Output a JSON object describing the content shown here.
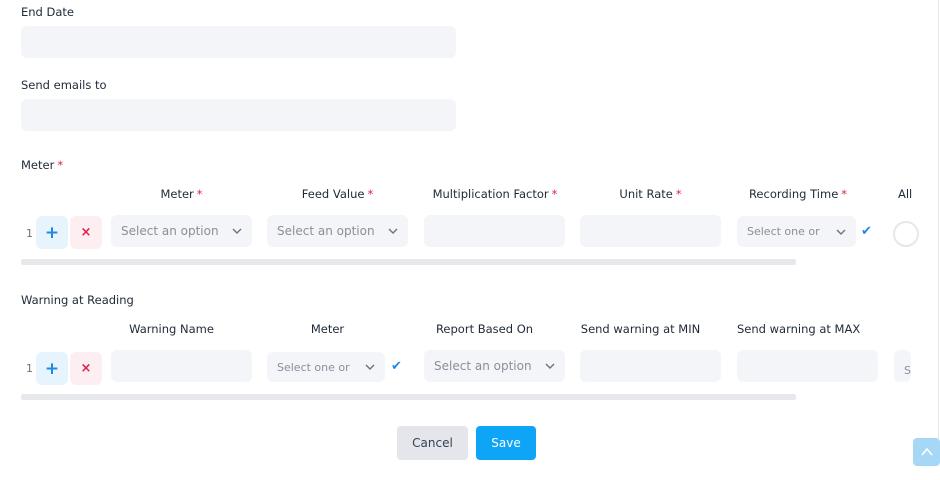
{
  "end_date": {
    "label": "End Date",
    "value": ""
  },
  "send_emails": {
    "label": "Send emails to",
    "value": ""
  },
  "meter_section": {
    "title": "Meter",
    "required_mark": "*",
    "columns": {
      "meter": "Meter",
      "feed_value": "Feed Value",
      "multiplication_factor": "Multiplication Factor",
      "unit_rate": "Unit Rate",
      "recording_time": "Recording Time",
      "all_partial": "All"
    },
    "row": {
      "number": "1",
      "add_symbol": "+",
      "delete_symbol": "×",
      "meter_placeholder": "Select an option",
      "feed_value_placeholder": "Select an option",
      "recording_time_placeholder": "Select one or",
      "check_symbol": "✔"
    }
  },
  "warning_section": {
    "title": "Warning at Reading",
    "columns": {
      "warning_name": "Warning Name",
      "meter": "Meter",
      "report_based_on": "Report Based On",
      "send_warning_min": "Send warning at MIN",
      "send_warning_max": "Send warning at MAX"
    },
    "row": {
      "number": "1",
      "add_symbol": "+",
      "delete_symbol": "×",
      "meter_placeholder": "Select one or",
      "report_based_placeholder": "Select an option",
      "check_symbol": "✔",
      "partial_text": "S"
    }
  },
  "actions": {
    "cancel": "Cancel",
    "save": "Save"
  },
  "colors": {
    "primary": "#0ea5f7",
    "danger": "#e11d48",
    "field_bg": "#f3f5f8"
  },
  "icons": {
    "chevron": "chevron-down-icon",
    "scroll_top": "arrow-up-icon"
  }
}
